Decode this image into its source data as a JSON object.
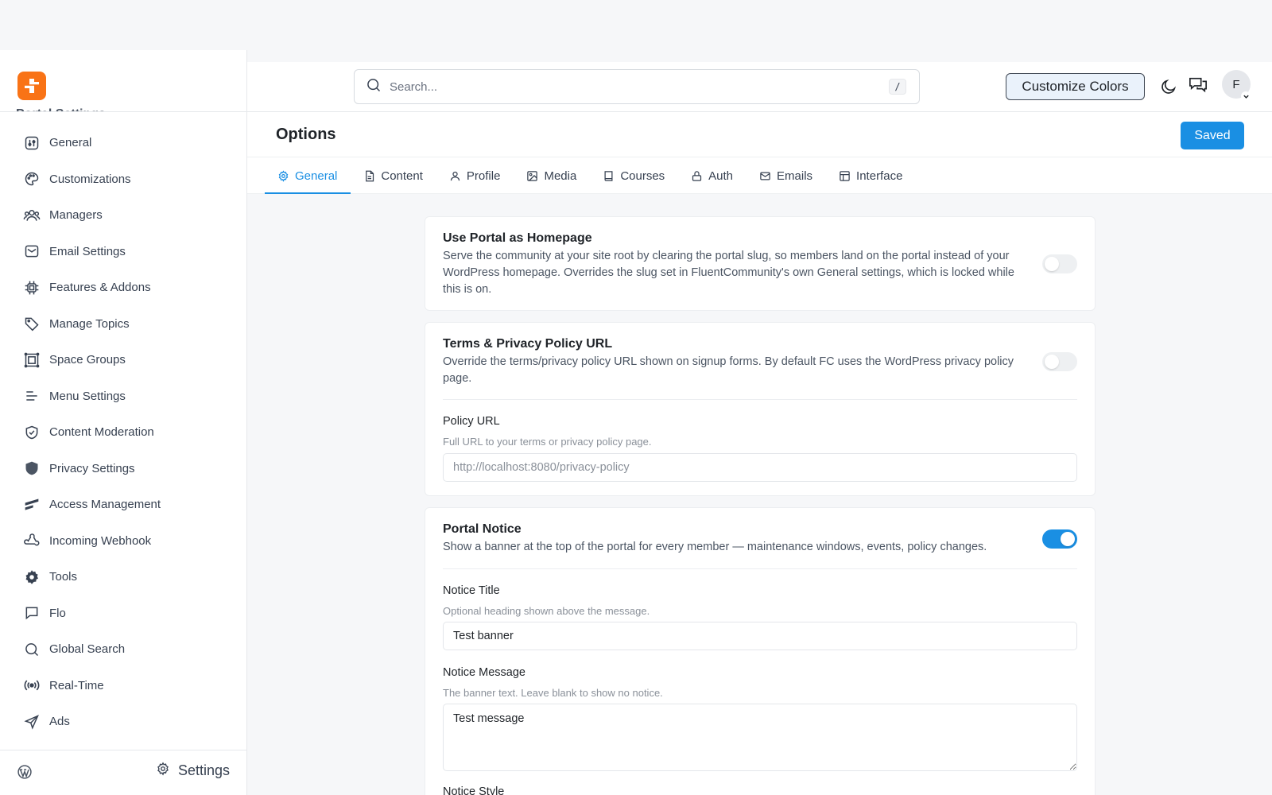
{
  "sidebar": {
    "section_title": "Portal Settings",
    "items": [
      {
        "label": "General",
        "icon": "sliders-icon"
      },
      {
        "label": "Customizations",
        "icon": "palette-icon"
      },
      {
        "label": "Managers",
        "icon": "users-icon"
      },
      {
        "label": "Email Settings",
        "icon": "mail-icon"
      },
      {
        "label": "Features & Addons",
        "icon": "chip-icon"
      },
      {
        "label": "Manage Topics",
        "icon": "tag-icon"
      },
      {
        "label": "Space Groups",
        "icon": "grid-icon"
      },
      {
        "label": "Menu Settings",
        "icon": "menu-icon"
      },
      {
        "label": "Content Moderation",
        "icon": "shield-check-icon"
      },
      {
        "label": "Privacy Settings",
        "icon": "shield-icon"
      },
      {
        "label": "Access Management",
        "icon": "access-icon"
      },
      {
        "label": "Incoming Webhook",
        "icon": "webhook-icon"
      },
      {
        "label": "Tools",
        "icon": "gear-icon"
      },
      {
        "label": "Flo",
        "icon": "chat-icon"
      },
      {
        "label": "Global Search",
        "icon": "search-icon"
      },
      {
        "label": "Real-Time",
        "icon": "broadcast-icon"
      },
      {
        "label": "Ads",
        "icon": "send-icon"
      }
    ],
    "footer_settings_label": "Settings"
  },
  "header": {
    "search_placeholder": "Search...",
    "search_shortcut": "/",
    "customize_label": "Customize Colors",
    "avatar_initial": "F"
  },
  "page": {
    "title": "Options",
    "saved_label": "Saved"
  },
  "tabs": [
    {
      "label": "General",
      "icon": "gear-icon",
      "active": true
    },
    {
      "label": "Content",
      "icon": "file-icon",
      "active": false
    },
    {
      "label": "Profile",
      "icon": "user-icon",
      "active": false
    },
    {
      "label": "Media",
      "icon": "image-icon",
      "active": false
    },
    {
      "label": "Courses",
      "icon": "book-icon",
      "active": false
    },
    {
      "label": "Auth",
      "icon": "lock-icon",
      "active": false
    },
    {
      "label": "Emails",
      "icon": "mail-icon",
      "active": false
    },
    {
      "label": "Interface",
      "icon": "layout-icon",
      "active": false
    }
  ],
  "cards": {
    "homepage": {
      "title": "Use Portal as Homepage",
      "description": "Serve the community at your site root by clearing the portal slug, so members land on the portal instead of your WordPress homepage. Overrides the slug set in FluentCommunity's own General settings, which is locked while this is on.",
      "enabled": false
    },
    "terms": {
      "title": "Terms & Privacy Policy URL",
      "description": "Override the terms/privacy policy URL shown on signup forms. By default FC uses the WordPress privacy policy page.",
      "enabled": false,
      "policy_label": "Policy URL",
      "policy_help": "Full URL to your terms or privacy policy page.",
      "policy_placeholder": "http://localhost:8080/privacy-policy",
      "policy_value": ""
    },
    "notice": {
      "title": "Portal Notice",
      "description": "Show a banner at the top of the portal for every member — maintenance windows, events, policy changes.",
      "enabled": true,
      "notice_title_label": "Notice Title",
      "notice_title_help": "Optional heading shown above the message.",
      "notice_title_value": "Test banner",
      "notice_message_label": "Notice Message",
      "notice_message_help": "The banner text. Leave blank to show no notice.",
      "notice_message_value": "Test message",
      "notice_style_label": "Notice Style"
    }
  },
  "colors": {
    "accent": "#1a8fe3",
    "logo": "#f97316"
  }
}
